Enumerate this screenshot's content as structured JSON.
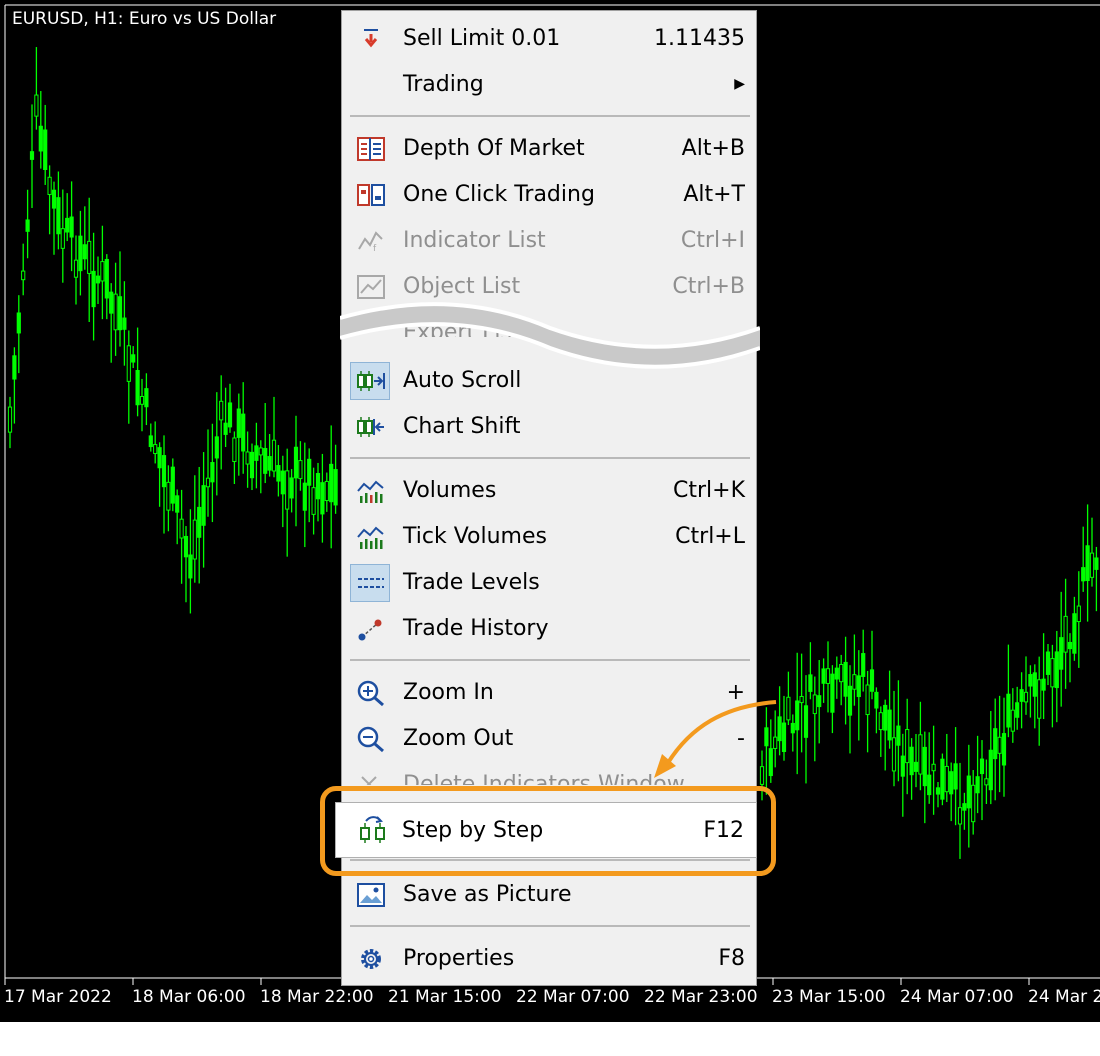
{
  "chart": {
    "title": "EURUSD, H1:  Euro vs US Dollar",
    "time_labels": [
      "17 Mar 2022",
      "18 Mar 06:00",
      "18 Mar 22:00",
      "21 Mar 15:00",
      "22 Mar 07:00",
      "22 Mar 23:00",
      "23 Mar 15:00",
      "24 Mar 07:00",
      "24 Mar 2"
    ]
  },
  "menu": {
    "sell_limit": {
      "label": "Sell Limit 0.01",
      "value": "1.11435"
    },
    "trading": {
      "label": "Trading"
    },
    "depth_of_market": {
      "label": "Depth Of Market",
      "shortcut": "Alt+B"
    },
    "one_click_trading": {
      "label": "One Click Trading",
      "shortcut": "Alt+T"
    },
    "indicator_list": {
      "label": "Indicator List",
      "shortcut": "Ctrl+I"
    },
    "object_list": {
      "label": "Object List",
      "shortcut": "Ctrl+B"
    },
    "expert_list": {
      "label": "Expert List"
    },
    "auto_scroll": {
      "label": "Auto Scroll"
    },
    "chart_shift": {
      "label": "Chart Shift"
    },
    "volumes": {
      "label": "Volumes",
      "shortcut": "Ctrl+K"
    },
    "tick_volumes": {
      "label": "Tick Volumes",
      "shortcut": "Ctrl+L"
    },
    "trade_levels": {
      "label": "Trade Levels"
    },
    "trade_history": {
      "label": "Trade History"
    },
    "zoom_in": {
      "label": "Zoom In",
      "shortcut": "+"
    },
    "zoom_out": {
      "label": "Zoom Out",
      "shortcut": "-"
    },
    "delete_indicators_window": {
      "label": "Delete Indicators Window"
    },
    "step_by_step": {
      "label": "Step by Step",
      "shortcut": "F12"
    },
    "save_as_picture": {
      "label": "Save as Picture"
    },
    "properties": {
      "label": "Properties",
      "shortcut": "F8"
    }
  },
  "colors": {
    "accent": "#f39a1e",
    "candle": "#00ff00",
    "chart_bg": "#000000",
    "menu_bg": "#f0f0f0"
  }
}
